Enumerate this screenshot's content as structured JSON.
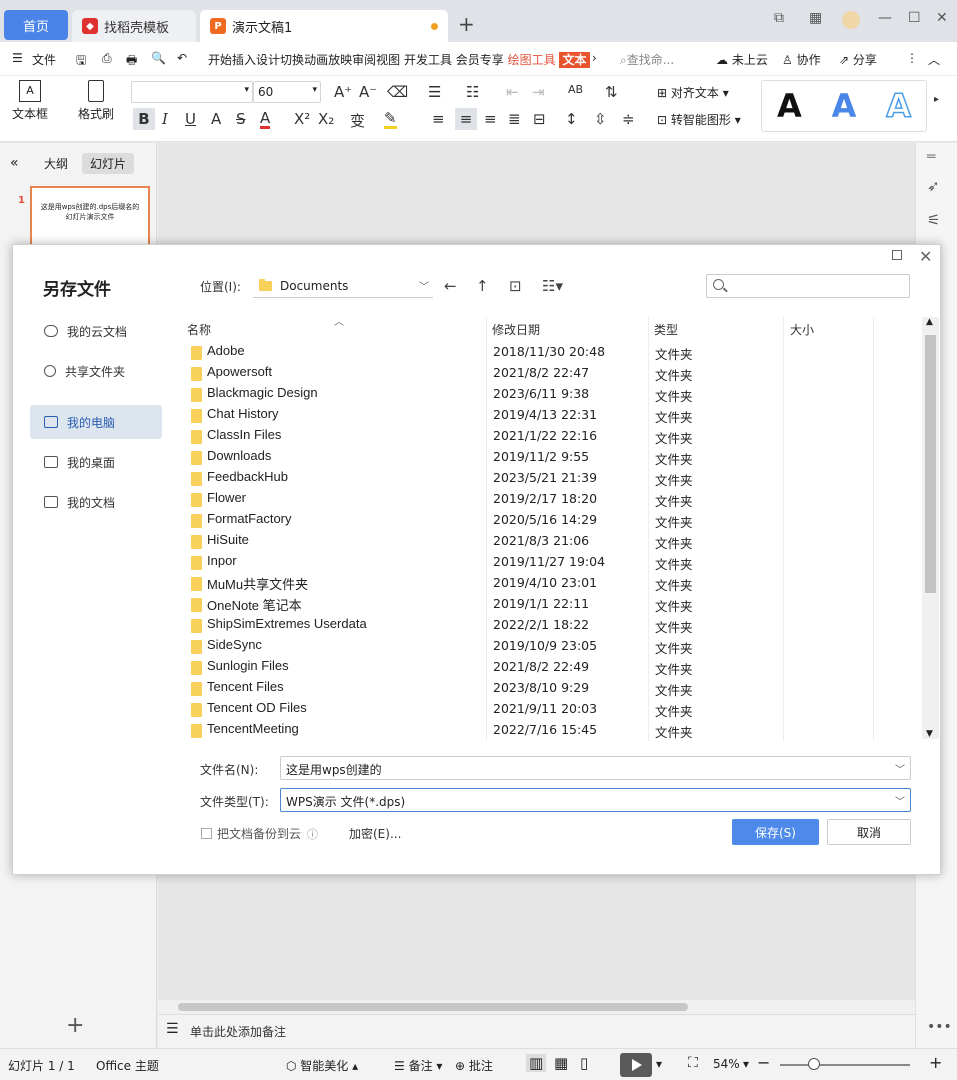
{
  "tabs": {
    "home": "首页",
    "templates": "找稻壳模板",
    "document": "演示文稿1"
  },
  "menu": {
    "file": "文件",
    "items": [
      "开始",
      "插入",
      "设计",
      "切换",
      "动画",
      "放映",
      "审阅",
      "视图",
      "开发工具",
      "会员专享"
    ],
    "drawing_tools": "绘图工具",
    "text_tools": "文本",
    "search": "查找命...",
    "cloud": "未上云",
    "collab": "协作",
    "share": "分享"
  },
  "ribbon": {
    "textbox": "文本框",
    "format_painter": "格式刷",
    "font_size": "60",
    "align_text": "对齐文本",
    "smart_shape": "转智能图形"
  },
  "left_panel": {
    "outline": "大纲",
    "slides": "幻灯片",
    "slide_number": "1",
    "thumb_text": "这是用wps创建的.dps后缀名的幻灯片演示文件"
  },
  "notes": "单击此处添加备注",
  "status": {
    "slide": "幻灯片 1 / 1",
    "theme": "Office 主题",
    "beautify": "智能美化",
    "notes": "备注",
    "comments": "批注",
    "zoom": "54%"
  },
  "dialog": {
    "title": "另存文件",
    "nav": [
      "我的云文档",
      "共享文件夹",
      "我的电脑",
      "我的桌面",
      "我的文档"
    ],
    "location_label": "位置(I):",
    "location": "Documents",
    "columns": {
      "name": "名称",
      "modified": "修改日期",
      "type": "类型",
      "size": "大小"
    },
    "files": [
      {
        "name": "Adobe",
        "date": "2018/11/30 20:48",
        "type": "文件夹"
      },
      {
        "name": "Apowersoft",
        "date": "2021/8/2 22:47",
        "type": "文件夹"
      },
      {
        "name": "Blackmagic Design",
        "date": "2023/6/11 9:38",
        "type": "文件夹"
      },
      {
        "name": "Chat History",
        "date": "2019/4/13 22:31",
        "type": "文件夹"
      },
      {
        "name": "ClassIn Files",
        "date": "2021/1/22 22:16",
        "type": "文件夹"
      },
      {
        "name": "Downloads",
        "date": "2019/11/2 9:55",
        "type": "文件夹"
      },
      {
        "name": "FeedbackHub",
        "date": "2023/5/21 21:39",
        "type": "文件夹"
      },
      {
        "name": "Flower",
        "date": "2019/2/17 18:20",
        "type": "文件夹"
      },
      {
        "name": "FormatFactory",
        "date": "2020/5/16 14:29",
        "type": "文件夹"
      },
      {
        "name": "HiSuite",
        "date": "2021/8/3 21:06",
        "type": "文件夹"
      },
      {
        "name": "Inpor",
        "date": "2019/11/27 19:04",
        "type": "文件夹"
      },
      {
        "name": "MuMu共享文件夹",
        "date": "2019/4/10 23:01",
        "type": "文件夹"
      },
      {
        "name": "OneNote 笔记本",
        "date": "2019/1/1 22:11",
        "type": "文件夹"
      },
      {
        "name": "ShipSimExtremes Userdata",
        "date": "2022/2/1 18:22",
        "type": "文件夹"
      },
      {
        "name": "SideSync",
        "date": "2019/10/9 23:05",
        "type": "文件夹"
      },
      {
        "name": "Sunlogin Files",
        "date": "2021/8/2 22:49",
        "type": "文件夹"
      },
      {
        "name": "Tencent Files",
        "date": "2023/8/10 9:29",
        "type": "文件夹"
      },
      {
        "name": "Tencent OD Files",
        "date": "2021/9/11 20:03",
        "type": "文件夹"
      },
      {
        "name": "TencentMeeting",
        "date": "2022/7/16 15:45",
        "type": "文件夹"
      }
    ],
    "filename_label": "文件名(N):",
    "filename": "这是用wps创建的",
    "filetype_label": "文件类型(T):",
    "filetype": "WPS演示 文件(*.dps)",
    "backup": "把文档备份到云",
    "encrypt": "加密(E)...",
    "save": "保存(S)",
    "cancel": "取消"
  }
}
